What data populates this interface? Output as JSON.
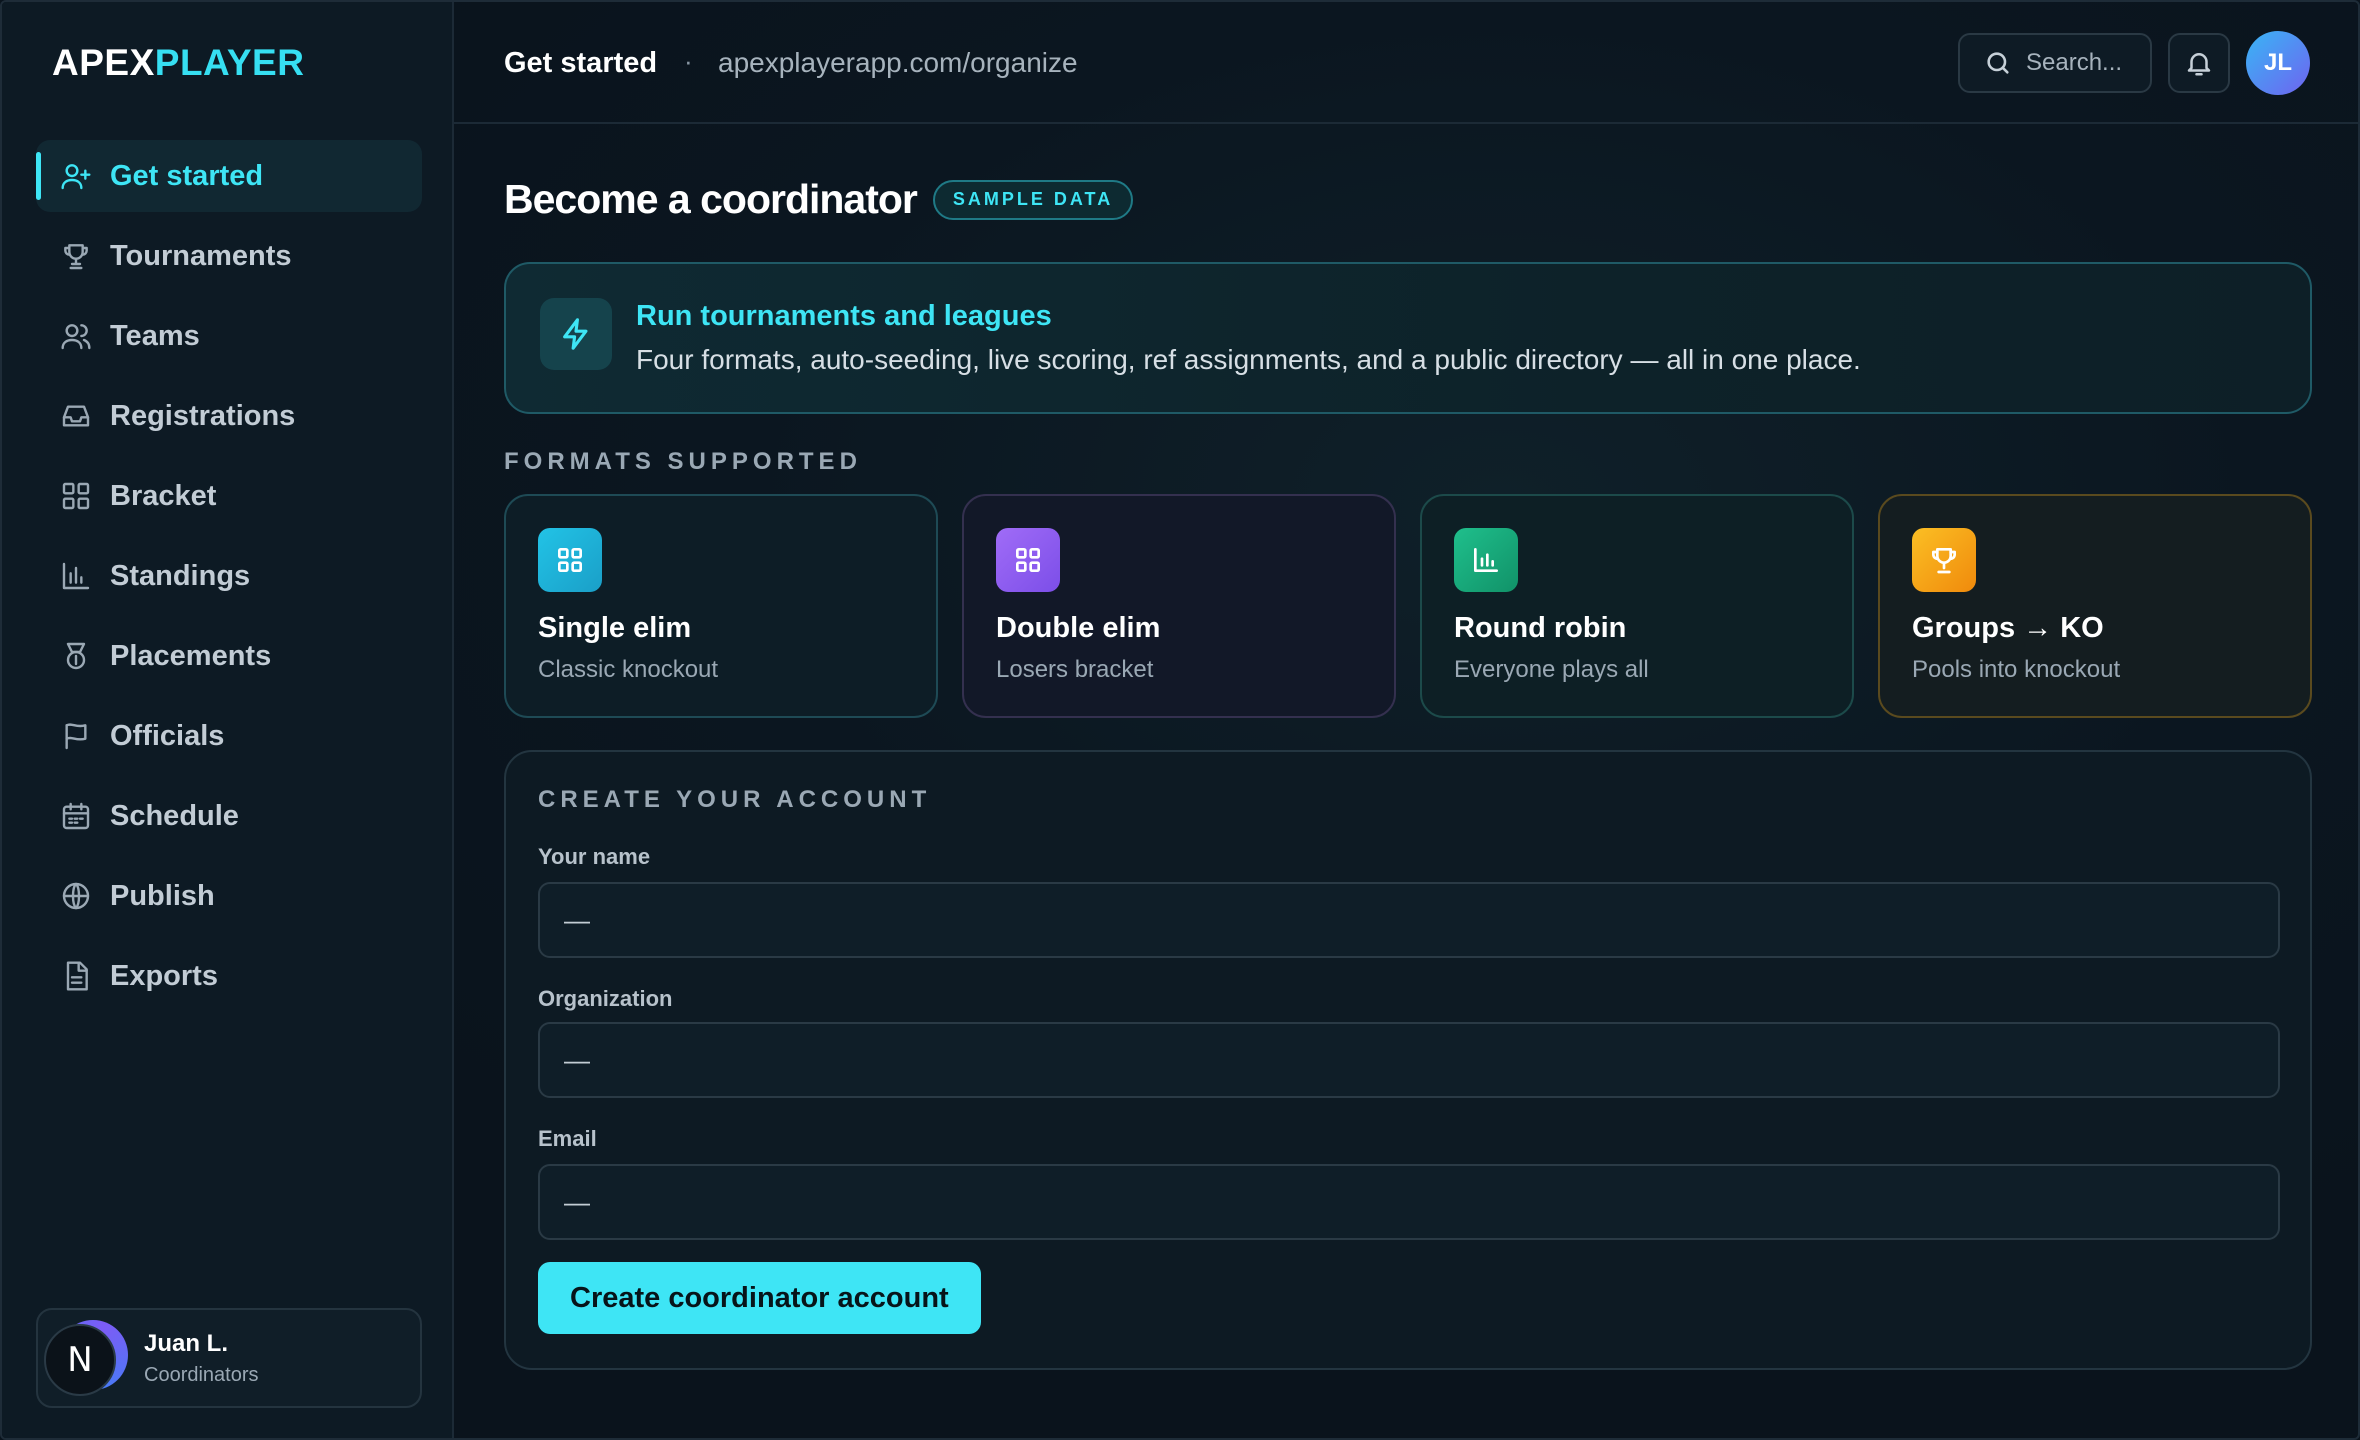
{
  "brand": {
    "part1": "APEX",
    "part2": "PLAYER"
  },
  "colors": {
    "accent": "#3ee5f5",
    "background": "#0a141d",
    "single_elim": "#1fb6d6",
    "double_elim": "#8b5cf6",
    "round_robin": "#16a37a",
    "groups_ko": "#f59e0b"
  },
  "sidebar": {
    "items": [
      {
        "label": "Get started",
        "icon": "user-plus-icon",
        "active": true
      },
      {
        "label": "Tournaments",
        "icon": "trophy-icon"
      },
      {
        "label": "Teams",
        "icon": "users-icon"
      },
      {
        "label": "Registrations",
        "icon": "inbox-icon"
      },
      {
        "label": "Bracket",
        "icon": "layout-grid-icon"
      },
      {
        "label": "Standings",
        "icon": "bar-chart-icon"
      },
      {
        "label": "Placements",
        "icon": "medal-icon"
      },
      {
        "label": "Officials",
        "icon": "flag-icon"
      },
      {
        "label": "Schedule",
        "icon": "calendar-icon"
      },
      {
        "label": "Publish",
        "icon": "globe-icon"
      },
      {
        "label": "Exports",
        "icon": "file-text-icon"
      }
    ],
    "user": {
      "initial": "N",
      "name": "Juan L.",
      "role": "Coordinators"
    }
  },
  "header": {
    "title": "Get started",
    "separator": "·",
    "url": "apexplayerapp.com/organize",
    "search_placeholder": "Search...",
    "avatar_initials": "JL"
  },
  "main": {
    "title": "Become a coordinator",
    "badge": "SAMPLE DATA",
    "hero": {
      "title": "Run tournaments and leagues",
      "subtitle": "Four formats, auto-seeding, live scoring, ref assignments, and a public directory — all in one place."
    },
    "formats_label": "FORMATS SUPPORTED",
    "formats": [
      {
        "name": "Single elim",
        "desc": "Classic knockout",
        "icon": "grid-icon"
      },
      {
        "name": "Double elim",
        "desc": "Losers bracket",
        "icon": "grid-icon"
      },
      {
        "name": "Round robin",
        "desc": "Everyone plays all",
        "icon": "bar-chart-icon"
      },
      {
        "name": "Groups → KO",
        "desc": "Pools into knockout",
        "icon": "trophy-icon"
      }
    ],
    "account": {
      "label": "CREATE YOUR ACCOUNT",
      "fields": [
        {
          "label": "Your name",
          "placeholder": "—"
        },
        {
          "label": "Organization",
          "placeholder": "—"
        },
        {
          "label": "Email",
          "placeholder": "—"
        }
      ],
      "submit": "Create coordinator account"
    }
  }
}
